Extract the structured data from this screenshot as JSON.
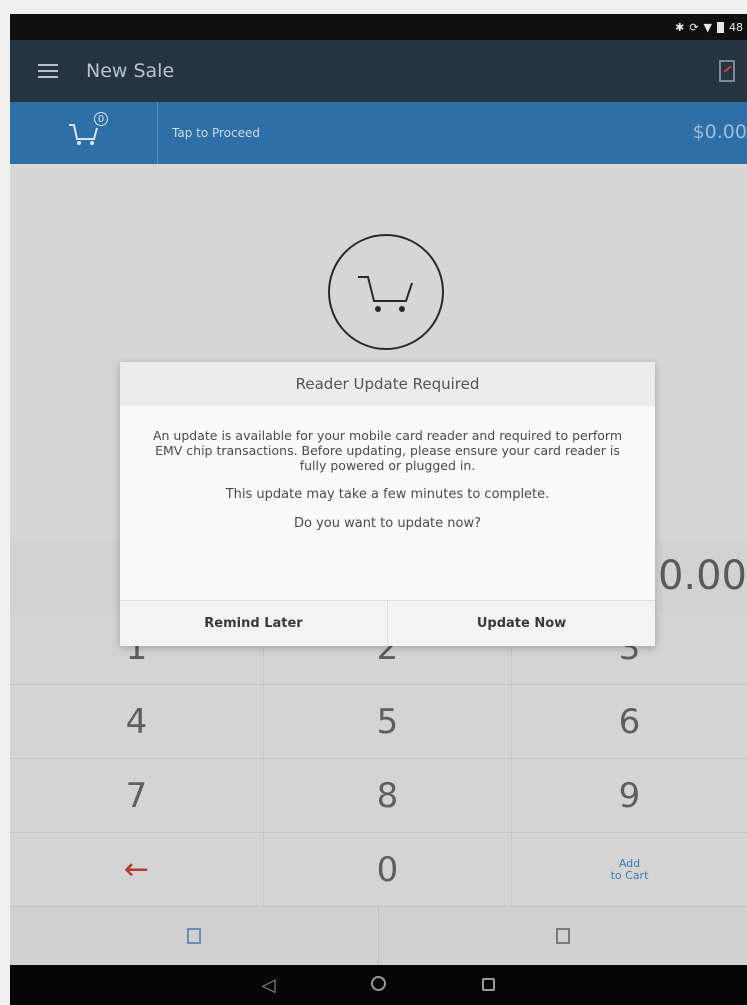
{
  "status_bar": {
    "icons": [
      "bluetooth-icon",
      "sync-icon",
      "wifi-icon",
      "battery-icon"
    ],
    "battery_text": "48"
  },
  "app_bar": {
    "title": "New Sale"
  },
  "cart_bar": {
    "badge": "0",
    "proceed_label": "Tap to Proceed",
    "total": "$0.00"
  },
  "amount": {
    "display": "0.00"
  },
  "keypad": {
    "keys": [
      "1",
      "2",
      "3",
      "4",
      "5",
      "6",
      "7",
      "8",
      "9",
      "←",
      "0"
    ],
    "add_to_cart_line1": "Add",
    "add_to_cart_line2": "to Cart"
  },
  "dialog": {
    "title": "Reader Update Required",
    "message": "An update is available for your mobile card reader and required to perform EMV chip transactions. Before updating, please ensure your card reader is fully powered or plugged in.",
    "duration": "This update may take a few minutes to complete.",
    "question": "Do you want to update now?",
    "remind_later_label": "Remind Later",
    "update_now_label": "Update Now"
  },
  "colors": {
    "app_bar": "#263340",
    "cart_bar": "#2d6fa6",
    "backspace": "#b63a30",
    "link": "#3f7bb0"
  }
}
